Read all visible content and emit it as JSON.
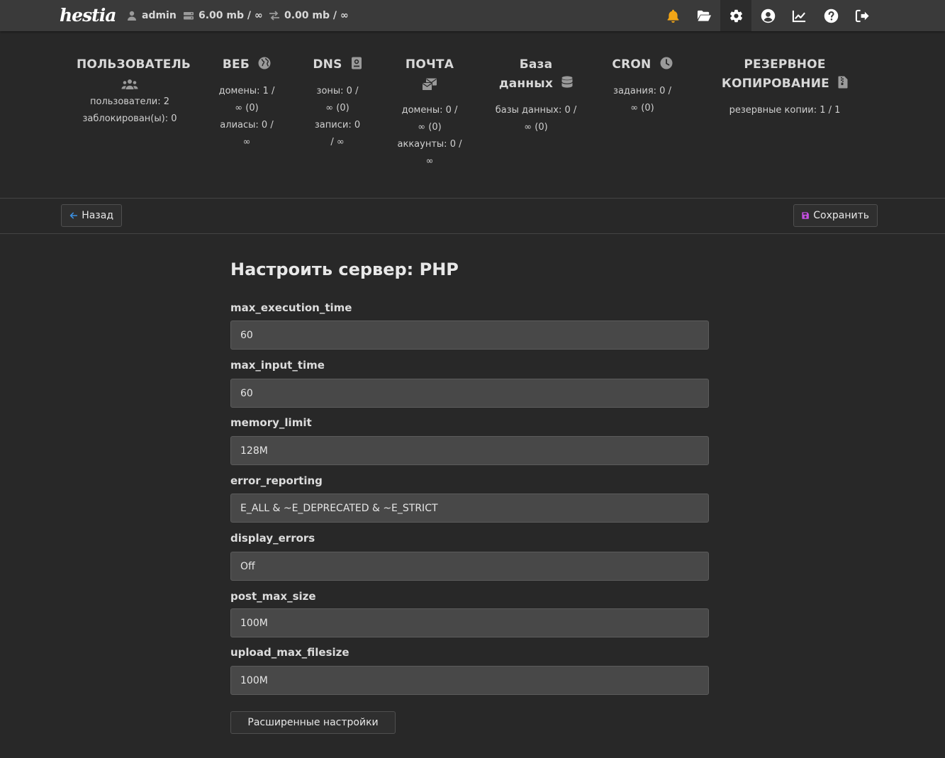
{
  "brand": {
    "logo_text": "hestia"
  },
  "topbar": {
    "username": "admin",
    "disk_usage": "6.00 mb / ∞",
    "bandwidth": "0.00 mb / ∞",
    "icons": [
      "bell-icon",
      "folder-open-icon",
      "gear-icon",
      "user-circle-icon",
      "chart-line-icon",
      "question-icon",
      "logout-icon"
    ],
    "notification_color": "#f2a516"
  },
  "stats": {
    "user": {
      "title": "ПОЛЬЗОВАТЕЛЬ",
      "lines": [
        "пользователи: 2",
        "заблокирован(ы): 0"
      ]
    },
    "web": {
      "title": "ВЕБ",
      "lines": [
        "домены: 1 /",
        "∞ (0)",
        "алиасы: 0 /",
        "∞"
      ]
    },
    "dns": {
      "title": "DNS",
      "lines": [
        "зоны: 0 /",
        "∞ (0)",
        "записи: 0",
        "/ ∞"
      ]
    },
    "mail": {
      "title": "ПОЧТА",
      "lines": [
        "домены: 0 /",
        "∞ (0)",
        "аккаунты: 0 /",
        "∞"
      ]
    },
    "db": {
      "title_line1": "База",
      "title_line2": "данных",
      "lines": [
        "базы данных: 0 /",
        "∞ (0)"
      ]
    },
    "cron": {
      "title": "CRON",
      "lines": [
        "задания: 0 /",
        "∞ (0)"
      ]
    },
    "backup": {
      "title_line1": "РЕЗЕРВНОЕ",
      "title_line2": "КОПИРОВАНИЕ",
      "lines": [
        "резервные копии: 1 / 1"
      ]
    }
  },
  "toolbar": {
    "back_label": "Назад",
    "save_label": "Сохранить",
    "back_icon_color": "#3b8fe0",
    "save_icon_color": "#c34ee0"
  },
  "form": {
    "title": "Настроить сервер: PHP",
    "fields": [
      {
        "label": "max_execution_time",
        "value": "60"
      },
      {
        "label": "max_input_time",
        "value": "60"
      },
      {
        "label": "memory_limit",
        "value": "128M"
      },
      {
        "label": "error_reporting",
        "value": "E_ALL & ~E_DEPRECATED & ~E_STRICT"
      },
      {
        "label": "display_errors",
        "value": "Off"
      },
      {
        "label": "post_max_size",
        "value": "100M"
      },
      {
        "label": "upload_max_filesize",
        "value": "100M"
      }
    ],
    "advanced_label": "Расширенные настройки"
  }
}
